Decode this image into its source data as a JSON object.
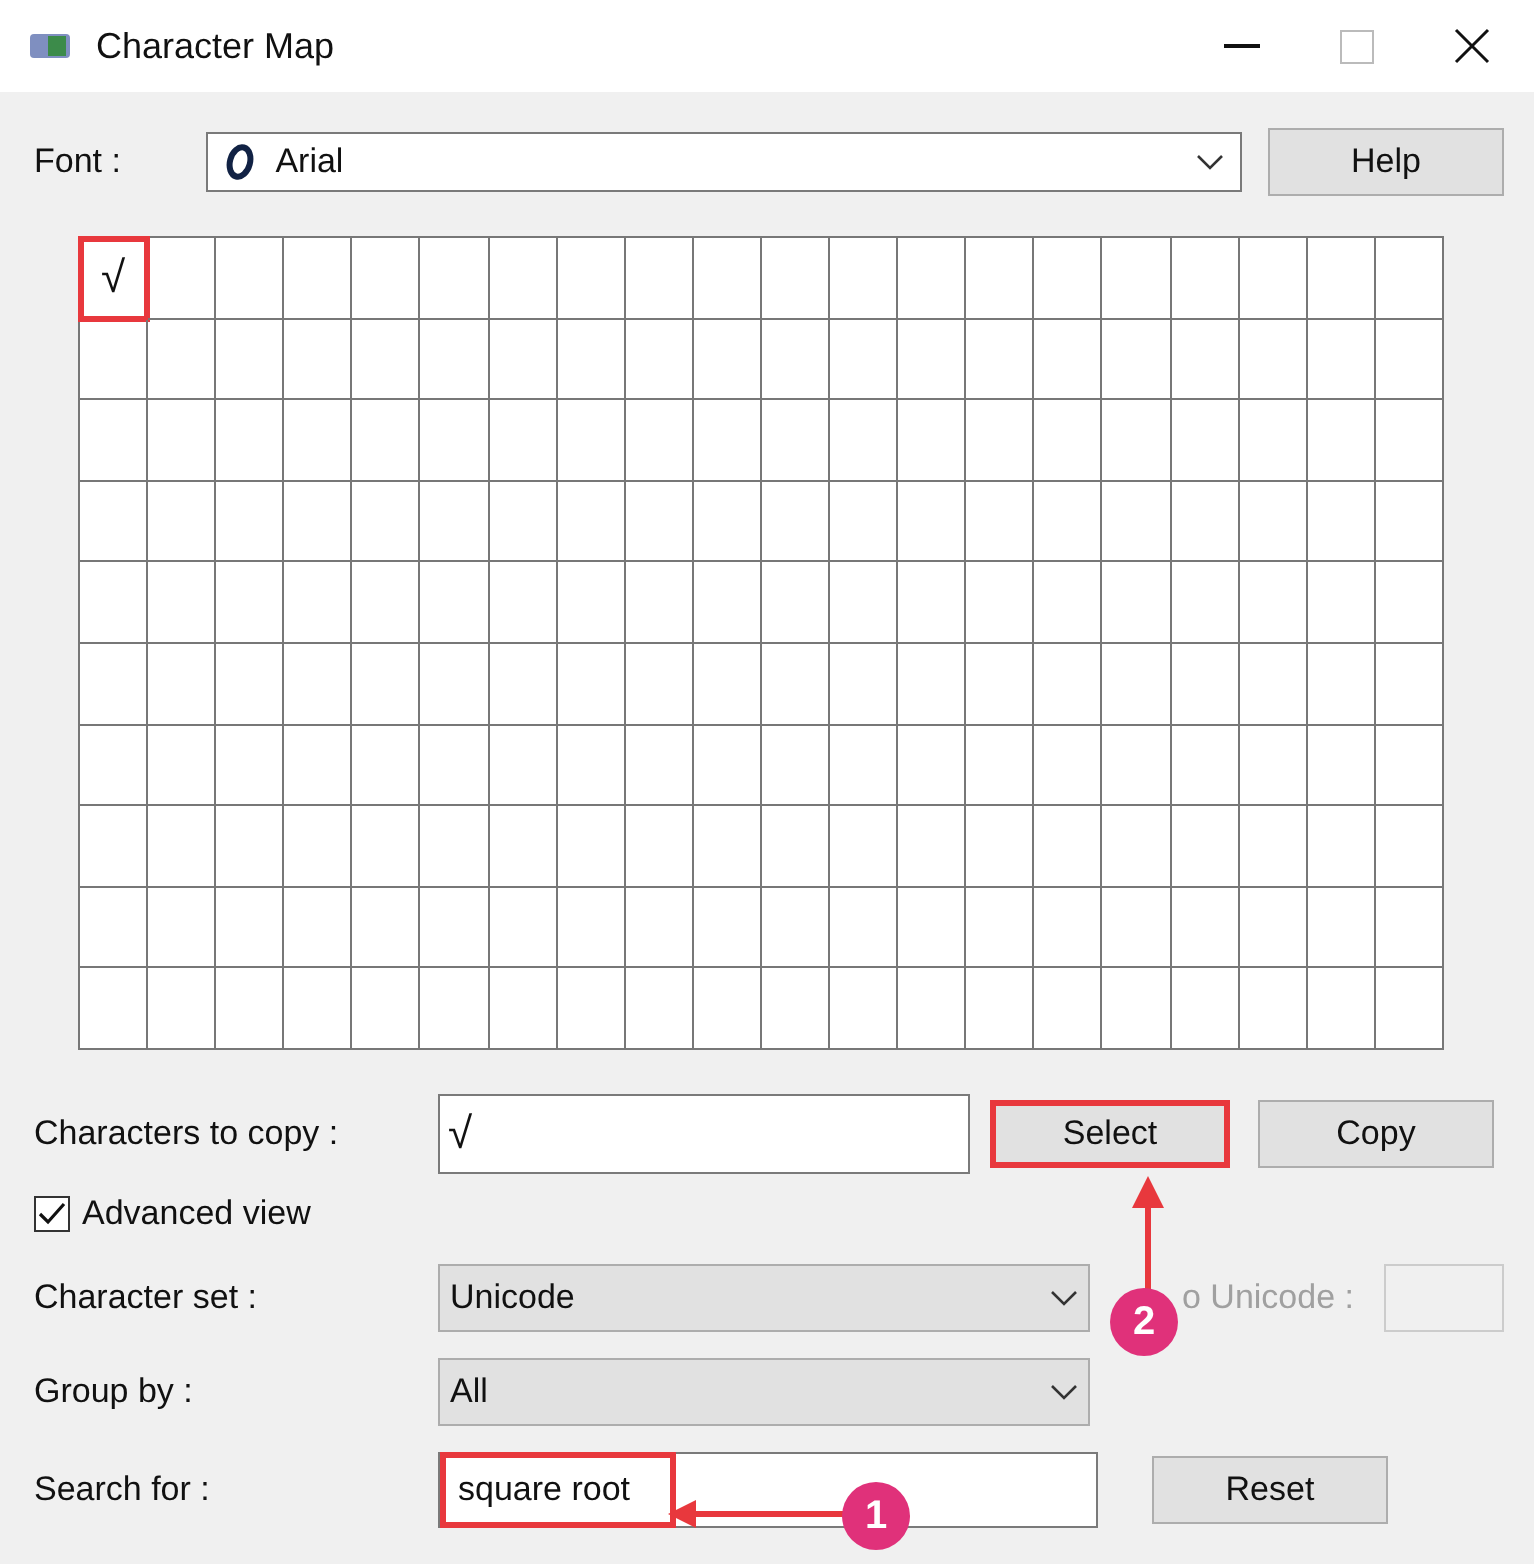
{
  "window": {
    "title": "Character Map"
  },
  "font": {
    "label": "Font :",
    "value": "Arial"
  },
  "help_button": "Help",
  "grid": {
    "cells": [
      {
        "char": "√",
        "selected": true
      }
    ]
  },
  "characters_to_copy": {
    "label": "Characters to copy :",
    "value": "√"
  },
  "select_button": {
    "label": "Select",
    "highlighted": true
  },
  "copy_button": "Copy",
  "advanced_view": {
    "label": "Advanced view",
    "checked": true
  },
  "character_set": {
    "label": "Character set :",
    "value": "Unicode"
  },
  "go_to_unicode": {
    "label": "o Unicode :",
    "disabled": true
  },
  "group_by": {
    "label": "Group by :",
    "value": "All"
  },
  "search": {
    "label": "Search for :",
    "value": "square root",
    "highlighted": true
  },
  "reset_button": "Reset",
  "callouts": [
    {
      "number": "1"
    },
    {
      "number": "2"
    }
  ]
}
